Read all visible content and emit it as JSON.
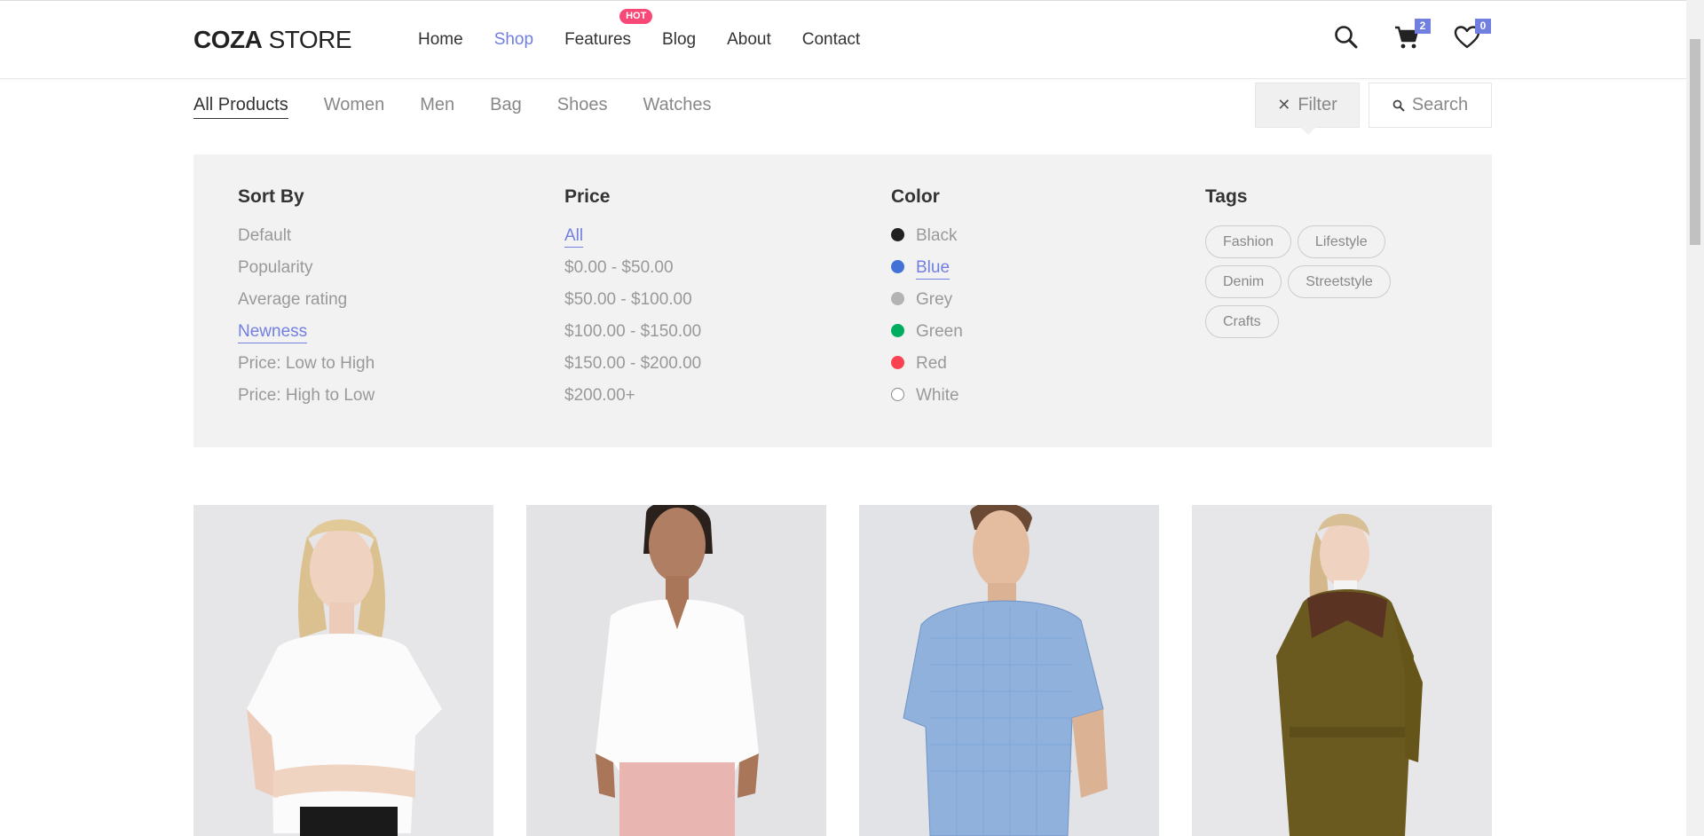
{
  "header": {
    "logo_bold": "COZA",
    "logo_light": " STORE",
    "nav": [
      {
        "label": "Home"
      },
      {
        "label": "Shop"
      },
      {
        "label": "Features",
        "badge": "HOT"
      },
      {
        "label": "Blog"
      },
      {
        "label": "About"
      },
      {
        "label": "Contact"
      }
    ],
    "active_nav": "Shop",
    "cart_count": "2",
    "wishlist_count": "0",
    "icons": [
      "search-icon",
      "cart-icon",
      "heart-icon"
    ]
  },
  "categories": {
    "items": [
      "All Products",
      "Women",
      "Men",
      "Bag",
      "Shoes",
      "Watches"
    ],
    "active": "All Products",
    "filter_label": "Filter",
    "search_label": "Search"
  },
  "filter_panel": {
    "sort": {
      "title": "Sort By",
      "options": [
        "Default",
        "Popularity",
        "Average rating",
        "Newness",
        "Price: Low to High",
        "Price: High to Low"
      ],
      "selected": "Newness"
    },
    "price": {
      "title": "Price",
      "options": [
        "All",
        "$0.00 - $50.00",
        "$50.00 - $100.00",
        "$100.00 - $150.00",
        "$150.00 - $200.00",
        "$200.00+"
      ],
      "selected": "All"
    },
    "color": {
      "title": "Color",
      "options": [
        {
          "label": "Black",
          "color": "#222222"
        },
        {
          "label": "Blue",
          "color": "#4272d7"
        },
        {
          "label": "Grey",
          "color": "#b3b3b3"
        },
        {
          "label": "Green",
          "color": "#00ad5f"
        },
        {
          "label": "Red",
          "color": "#fa4251"
        },
        {
          "label": "White",
          "color": "#ffffff"
        }
      ],
      "selected": "Blue"
    },
    "tags": {
      "title": "Tags",
      "items": [
        "Fashion",
        "Lifestyle",
        "Denim",
        "Streetstyle",
        "Crafts"
      ]
    }
  },
  "colors": {
    "accent": "#717fe0",
    "hot_badge": "#f74877",
    "panel_bg": "#f2f2f2"
  },
  "products": [
    {
      "image": "woman-white-tshirt"
    },
    {
      "image": "woman-white-shirt-pink-pants"
    },
    {
      "image": "man-blue-check-shirt"
    },
    {
      "image": "woman-olive-coat"
    }
  ]
}
